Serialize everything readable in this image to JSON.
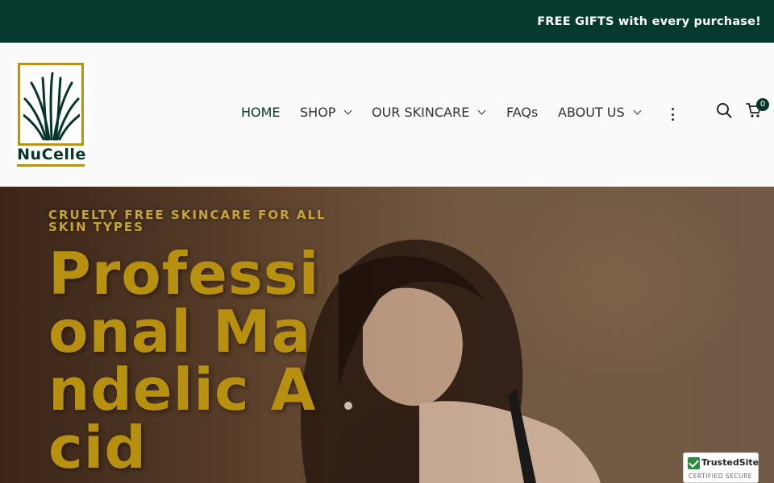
{
  "announcement": {
    "text": "FREE GIFTS with every purchase!"
  },
  "brand": {
    "logo_text_main": "NuCelle",
    "colors": {
      "green": "#06352b",
      "gold": "#b8911a"
    }
  },
  "nav": {
    "items": [
      {
        "label": "HOME",
        "active": true,
        "dropdown": false
      },
      {
        "label": "SHOP",
        "active": false,
        "dropdown": true
      },
      {
        "label": "OUR SKINCARE",
        "active": false,
        "dropdown": true
      },
      {
        "label": "FAQs",
        "active": false,
        "dropdown": false
      },
      {
        "label": "ABOUT US",
        "active": false,
        "dropdown": true
      }
    ],
    "more_icon": "vertical-dots-icon",
    "search_icon": "search-icon",
    "cart_icon": "cart-icon",
    "cart_count": "0"
  },
  "hero": {
    "eyebrow": "CRUELTY FREE SKINCARE FOR ALL SKIN TYPES",
    "headline": "Professional Mandelic Acid"
  },
  "badge": {
    "name": "TrustedSite",
    "sub": "CERTIFIED SECURE"
  }
}
